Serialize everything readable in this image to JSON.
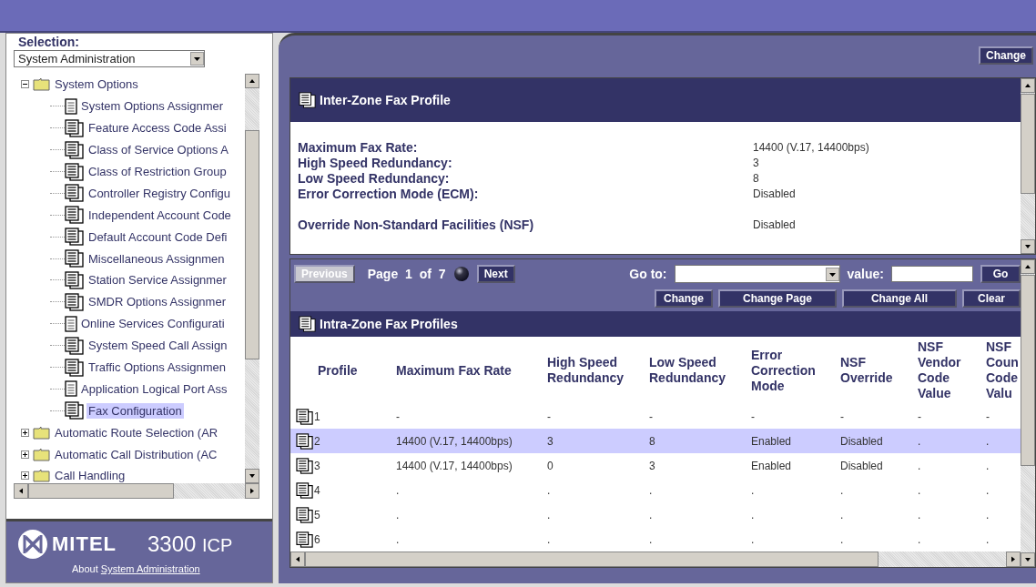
{
  "selection": {
    "label": "Selection:",
    "value": "System Administration"
  },
  "tree": [
    {
      "kind": "folder",
      "label": "System Options",
      "expanded": true,
      "selected": false,
      "children": [
        {
          "kind": "page",
          "label": "System Options Assignmer",
          "selected": false
        },
        {
          "kind": "pages",
          "label": "Feature Access Code Assi",
          "selected": false
        },
        {
          "kind": "pages",
          "label": "Class of Service Options A",
          "selected": false
        },
        {
          "kind": "pages",
          "label": "Class of Restriction Group",
          "selected": false
        },
        {
          "kind": "pages",
          "label": "Controller Registry Configu",
          "selected": false
        },
        {
          "kind": "pages",
          "label": "Independent Account Code",
          "selected": false
        },
        {
          "kind": "pages",
          "label": "Default Account Code Defi",
          "selected": false
        },
        {
          "kind": "pages",
          "label": "Miscellaneous Assignmen",
          "selected": false
        },
        {
          "kind": "pages",
          "label": "Station Service Assignmer",
          "selected": false
        },
        {
          "kind": "pages",
          "label": "SMDR Options Assignmer",
          "selected": false
        },
        {
          "kind": "page",
          "label": "Online Services Configurati",
          "selected": false
        },
        {
          "kind": "pages",
          "label": "System Speed Call Assign",
          "selected": false
        },
        {
          "kind": "pages",
          "label": "Traffic Options Assignmen",
          "selected": false
        },
        {
          "kind": "page",
          "label": "Application Logical Port Ass",
          "selected": false
        },
        {
          "kind": "pages",
          "label": "Fax Configuration",
          "selected": true
        }
      ]
    },
    {
      "kind": "folder",
      "label": "Automatic Route Selection (AR",
      "expanded": false,
      "selected": false
    },
    {
      "kind": "folder",
      "label": "Automatic Call Distribution (AC",
      "expanded": false,
      "selected": false
    },
    {
      "kind": "folder",
      "label": "Call Handling",
      "expanded": false,
      "selected": false
    }
  ],
  "brand": {
    "logo": "MITEL",
    "product": "3300",
    "product_suffix": "ICP",
    "about": "About",
    "about_link": "System Administration"
  },
  "toolbar": {
    "button": "Change"
  },
  "inter_zone": {
    "title": "Inter-Zone Fax Profile",
    "fields": [
      {
        "label": "Maximum Fax Rate:",
        "value": "14400 (V.17, 14400bps)"
      },
      {
        "label": "High Speed Redundancy:",
        "value": "3"
      },
      {
        "label": "Low Speed Redundancy:",
        "value": "8"
      },
      {
        "label": "Error Correction Mode (ECM):",
        "value": "Disabled"
      },
      {
        "label": "Override Non-Standard Facilities (NSF)",
        "value": "Disabled"
      }
    ]
  },
  "pager": {
    "previous": {
      "label": "Previous",
      "disabled": true
    },
    "page": "Page 1 of 7",
    "next": {
      "label": "Next",
      "disabled": false
    },
    "goto_label": "Go to:",
    "value_label": "value:",
    "go": "Go",
    "actions": [
      "Change",
      "Change Page",
      "Change All",
      "Clear"
    ]
  },
  "intra_zone": {
    "title": "Intra-Zone Fax Profiles",
    "columns": [
      "Profile",
      "Maximum Fax Rate",
      "High Speed Redundancy",
      "Low Speed Redundancy",
      "Error Correction Mode",
      "NSF Override",
      "NSF Vendor Code Value",
      "NSF Coun Code Valu"
    ],
    "rows": [
      {
        "selected": false,
        "cells": [
          "1",
          "-",
          "-",
          "-",
          "-",
          "-",
          "-",
          "-"
        ]
      },
      {
        "selected": true,
        "cells": [
          "2",
          "14400 (V.17, 14400bps)",
          "3",
          "8",
          "Enabled",
          "Disabled",
          ".",
          "."
        ]
      },
      {
        "selected": false,
        "cells": [
          "3",
          "14400 (V.17, 14400bps)",
          "0",
          "3",
          "Enabled",
          "Disabled",
          ".",
          "."
        ]
      },
      {
        "selected": false,
        "cells": [
          "4",
          ".",
          ".",
          ".",
          ".",
          ".",
          ".",
          "."
        ]
      },
      {
        "selected": false,
        "cells": [
          "5",
          ".",
          ".",
          ".",
          ".",
          ".",
          ".",
          "."
        ]
      },
      {
        "selected": false,
        "cells": [
          "6",
          ".",
          ".",
          ".",
          ".",
          ".",
          ".",
          "."
        ]
      }
    ]
  }
}
